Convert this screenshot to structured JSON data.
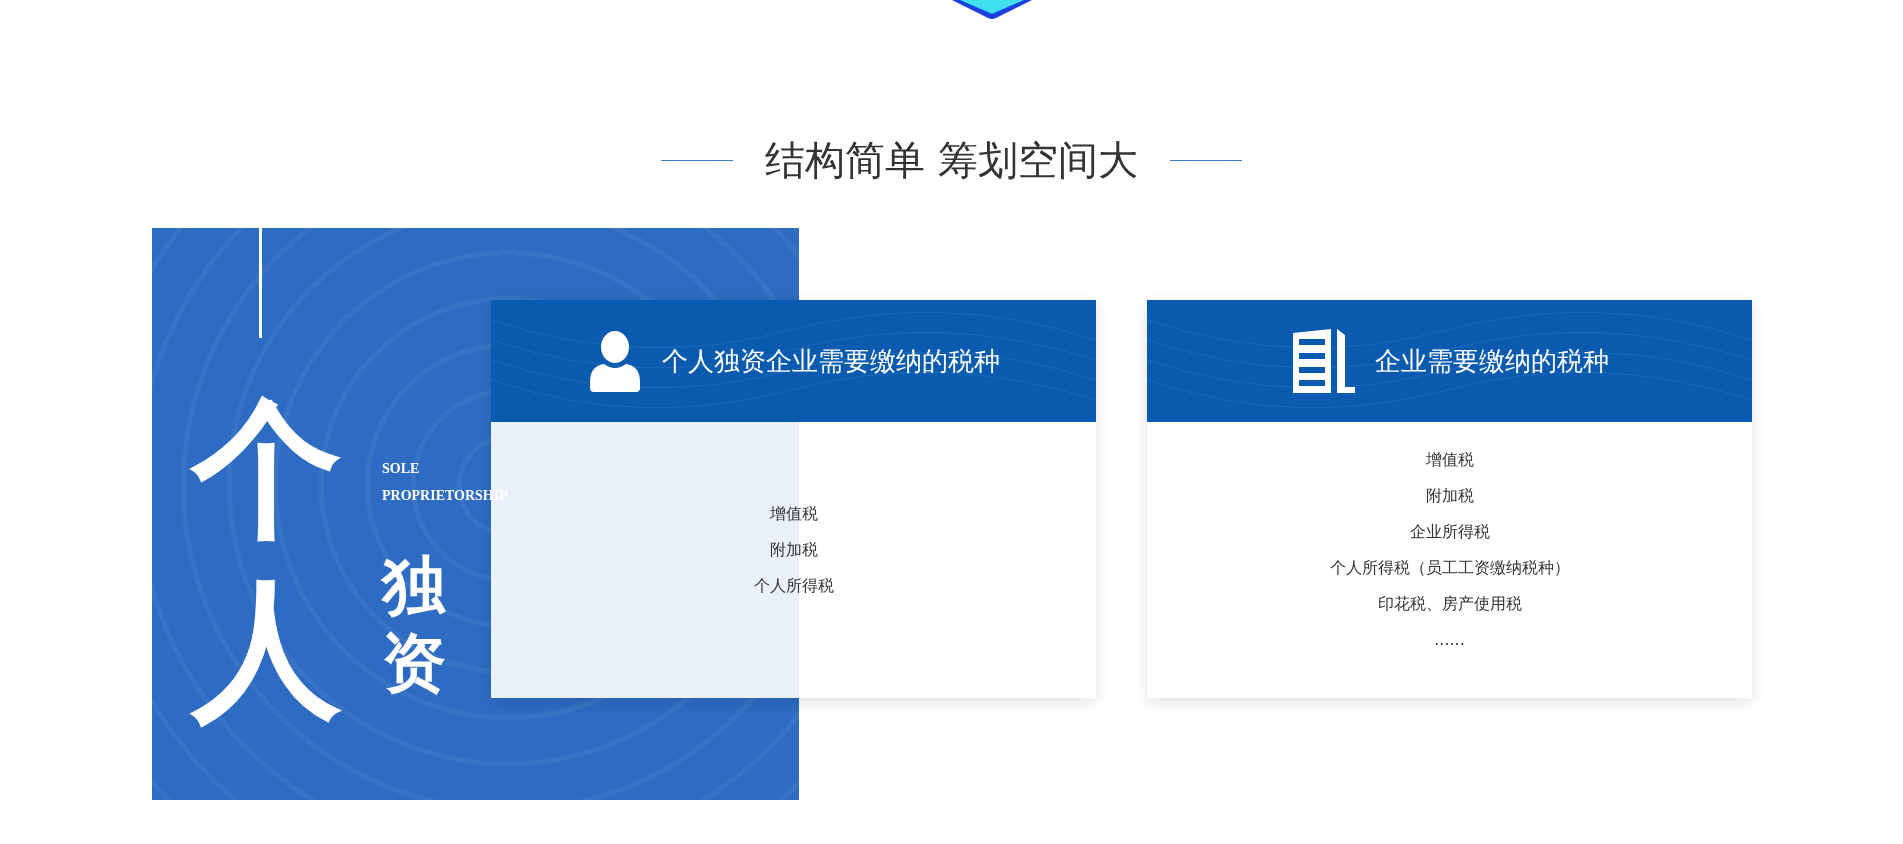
{
  "section_title": "结构简单 筹划空间大",
  "feature_panel": {
    "calligraphy_main": "个人",
    "calligraphy_side": "独资",
    "english_lines": [
      "SOLE",
      "PROPRIETORSHIP"
    ]
  },
  "cards": [
    {
      "kind": "person",
      "title": "个人独资企业需要缴纳的税种",
      "items": [
        "增值税",
        "附加税",
        "个人所得税"
      ]
    },
    {
      "kind": "building",
      "title": "企业需要缴纳的税种",
      "items": [
        "增值税",
        "附加税",
        "企业所得税",
        "个人所得税（员工工资缴纳税种）",
        "印花税、房产使用税",
        "......"
      ]
    }
  ]
}
